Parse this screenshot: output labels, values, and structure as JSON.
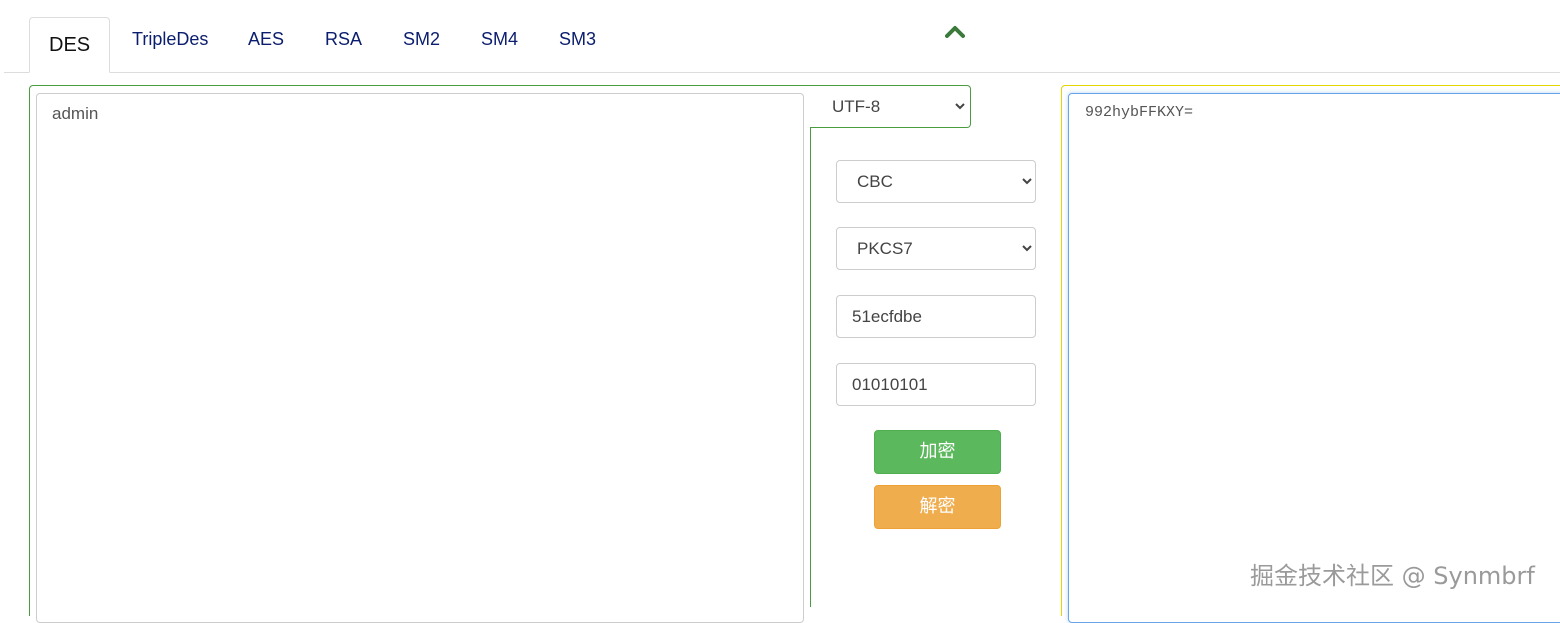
{
  "tabs": [
    {
      "label": "DES",
      "active": true
    },
    {
      "label": "TripleDes"
    },
    {
      "label": "AES"
    },
    {
      "label": "RSA"
    },
    {
      "label": "SM2"
    },
    {
      "label": "SM4"
    },
    {
      "label": "SM3"
    }
  ],
  "icons": {
    "collapse": "chevron-up-icon"
  },
  "colors": {
    "tab_text": "#0b1d6e",
    "left_panel_border": "#4a9d3f",
    "right_panel_border": "#e6d600",
    "encrypt_button": "#5cb85c",
    "decrypt_button": "#f0ad4e",
    "focus_border": "#6aa4e8"
  },
  "plaintext": {
    "value": "admin"
  },
  "encoding": {
    "selected": "UTF-8"
  },
  "mode": {
    "selected": "CBC"
  },
  "padding": {
    "selected": "PKCS7"
  },
  "key": {
    "value": "51ecfdbe"
  },
  "iv": {
    "value": "01010101"
  },
  "buttons": {
    "encrypt": "加密",
    "decrypt": "解密"
  },
  "ciphertext": {
    "value": "992hybFFKXY="
  },
  "watermark": "掘金技术社区 @ Synmbrf"
}
